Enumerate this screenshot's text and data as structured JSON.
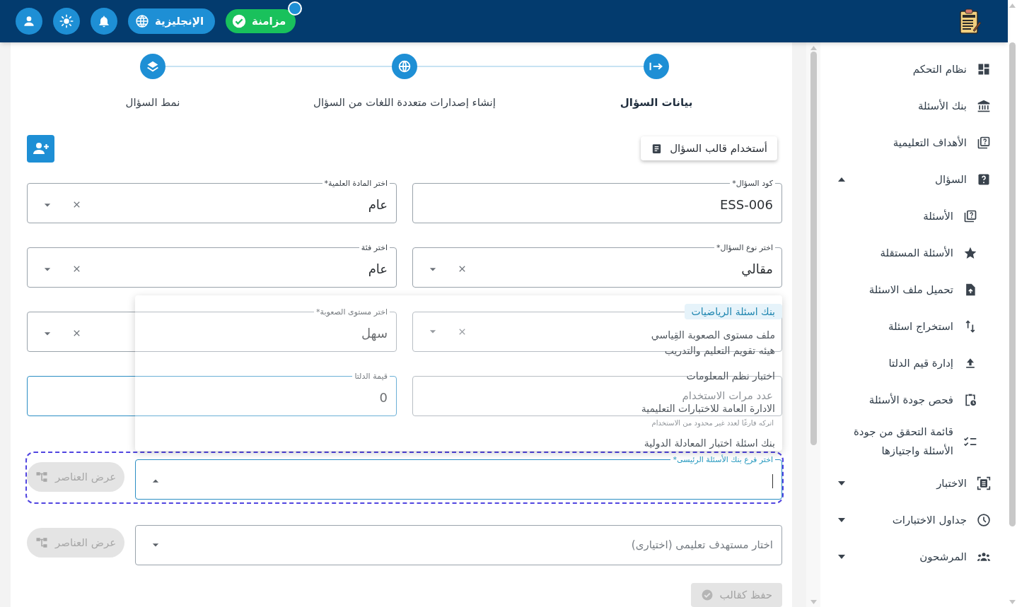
{
  "header": {
    "sync": {
      "label": "مزامنة",
      "notification": true
    },
    "language": {
      "label": "الإنجليزية"
    }
  },
  "sidebar": {
    "items": [
      {
        "label": "نظام التحكم"
      },
      {
        "label": "بنك الأسئلة"
      },
      {
        "label": "الأهداف التعليمية"
      },
      {
        "label": "السؤال",
        "expanded": true,
        "children": [
          {
            "label": "الأسئلة"
          },
          {
            "label": "الأسئلة المستقلة"
          },
          {
            "label": "تحميل ملف الاسئلة"
          },
          {
            "label": "استخراج اسئلة"
          },
          {
            "label": "إدارة قيم الدلتا"
          },
          {
            "label": "فحص جودة الأسئلة"
          },
          {
            "label": "قائمة التحقق من جودة الأسئلة واجتيازها"
          }
        ]
      },
      {
        "label": "الاختبار",
        "expanded": false
      },
      {
        "label": "جداول الاختبارات",
        "expanded": false
      },
      {
        "label": "المرشحون",
        "expanded": false
      }
    ]
  },
  "steps": [
    {
      "label": "بيانات السؤال",
      "selected": true
    },
    {
      "label": "إنشاء إصدارات متعددة اللغات من السؤال",
      "selected": false
    },
    {
      "label": "نمط السؤال",
      "selected": false
    }
  ],
  "template_button": {
    "label": "أستخدام قالب السؤال"
  },
  "field_rows": [
    [
      {
        "kind": "text",
        "label": "كود السؤال*",
        "value": "ESS-006"
      },
      {
        "kind": "select",
        "label": "اختر المادة العلمية*",
        "value": "عام"
      }
    ],
    [
      {
        "kind": "select",
        "label": "اختر نوع السؤال*",
        "value": "مقالي"
      },
      {
        "kind": "select",
        "label": "اختر فئة",
        "value": "عام"
      }
    ],
    [
      {
        "kind": "select"
      },
      {
        "kind": "select",
        "label": "اختر مستوى الصعوبة*",
        "value": "سهل"
      }
    ],
    [
      {
        "kind": "text",
        "placeholder": "عدد مرات الاستخدام"
      },
      {
        "kind": "text",
        "label": "قيمة الدلتا",
        "value": "0",
        "focused": true
      }
    ]
  ],
  "usage_hint": "اتركه فارغًا لعدد غير محدود من الاستخدام",
  "lookups": [
    {
      "label": "اختر فرع بنك الأسئلة الرئيسى*",
      "focused": true,
      "expanded": true,
      "button": {
        "label": "عرض العناصر",
        "disabled": true
      },
      "options": [
        {
          "label": "بنك اسئلة الرياضيات",
          "selected": true
        },
        {
          "label": "ملف مستوى الصعوبة القِياسي",
          "selected": false
        },
        {
          "label": "هيئه تقويم التعليم والتدريب",
          "selected": false
        },
        {
          "label": "اختبار نظم المعلومات",
          "selected": false
        },
        {
          "label": "الادارة العامة للاختبارات التعليمية",
          "selected": false
        },
        {
          "label": "بنك اسئلة اختبار المعادلة الدولية",
          "selected": false
        }
      ]
    },
    {
      "placeholder": "اختار مستهدف تعليمى (اختيارى)",
      "focused": false,
      "expanded": false,
      "button": {
        "label": "عرض العناصر",
        "disabled": true
      }
    }
  ],
  "save_button": {
    "label": "حفظ كقالب",
    "disabled": true
  }
}
